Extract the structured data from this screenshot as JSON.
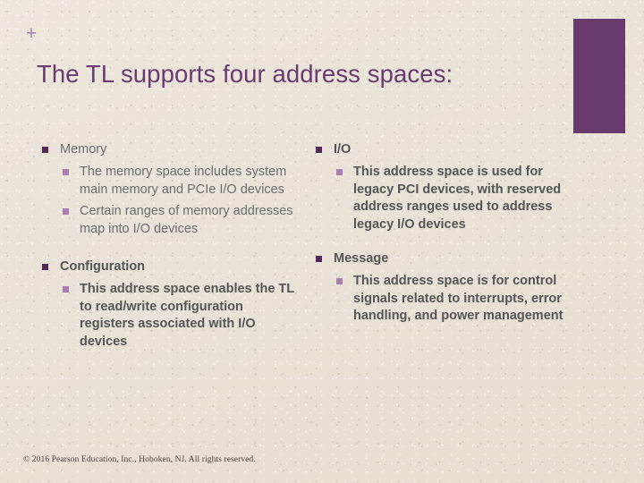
{
  "slide": {
    "plus_mark": "+",
    "title": "The TL supports four address spaces:",
    "accent_color": "#683a6e",
    "title_color": "#6a3a72",
    "background_color": "#ebe4d8",
    "bullet_level1_color": "#56295c",
    "bullet_level2_color": "#a87fb0"
  },
  "columns": {
    "left": [
      {
        "heading": "Memory",
        "points": [
          "The memory space includes system main memory and PCIe I/O devices",
          "Certain ranges of memory addresses map into I/O devices"
        ]
      },
      {
        "heading": "Configuration",
        "points": [
          "This address space enables the TL to read/write configuration registers associated with I/O devices"
        ]
      }
    ],
    "right": [
      {
        "heading": "I/O",
        "points": [
          "This address space is used for legacy PCI devices, with reserved address ranges used to address legacy I/O devices"
        ]
      },
      {
        "heading": "Message",
        "points": [
          "This address space is for control signals related to interrupts, error handling, and power management"
        ]
      }
    ]
  },
  "footer": {
    "copyright": "© 2016 Pearson Education, Inc., Hoboken, NJ. All rights reserved."
  }
}
